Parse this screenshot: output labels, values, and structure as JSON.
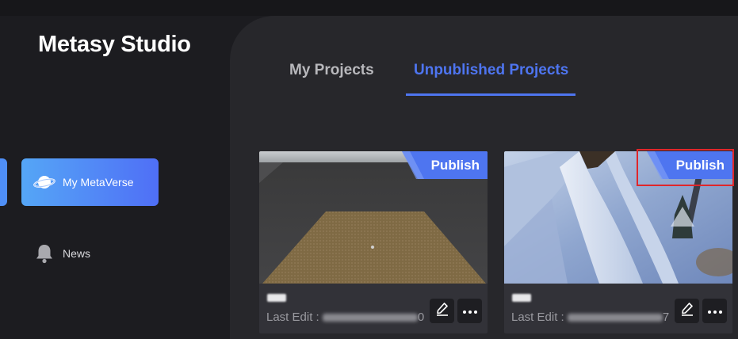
{
  "app": {
    "title": "Metasy Studio"
  },
  "sidebar": {
    "items": [
      {
        "label": "My MetaVerse",
        "icon": "planet-icon",
        "active": true
      },
      {
        "label": "News",
        "icon": "bell-icon",
        "active": false
      }
    ]
  },
  "tabs": [
    {
      "label": "My Projects",
      "active": false
    },
    {
      "label": "Unpublished Projects",
      "active": true
    }
  ],
  "projects": [
    {
      "publish_label": "Publish",
      "last_edit_label": "Last Edit :",
      "last_edit_tail": "0",
      "thumbnail": "brown-plane-in-gray-room"
    },
    {
      "publish_label": "Publish",
      "last_edit_label": "Last Edit :",
      "last_edit_tail": "7",
      "thumbnail": "snowy-mountain-slope"
    }
  ],
  "colors": {
    "accent": "#4e75f0",
    "nav_gradient_start": "#55a6f6",
    "nav_gradient_end": "#4f6ff6",
    "highlight": "#e0262a"
  }
}
